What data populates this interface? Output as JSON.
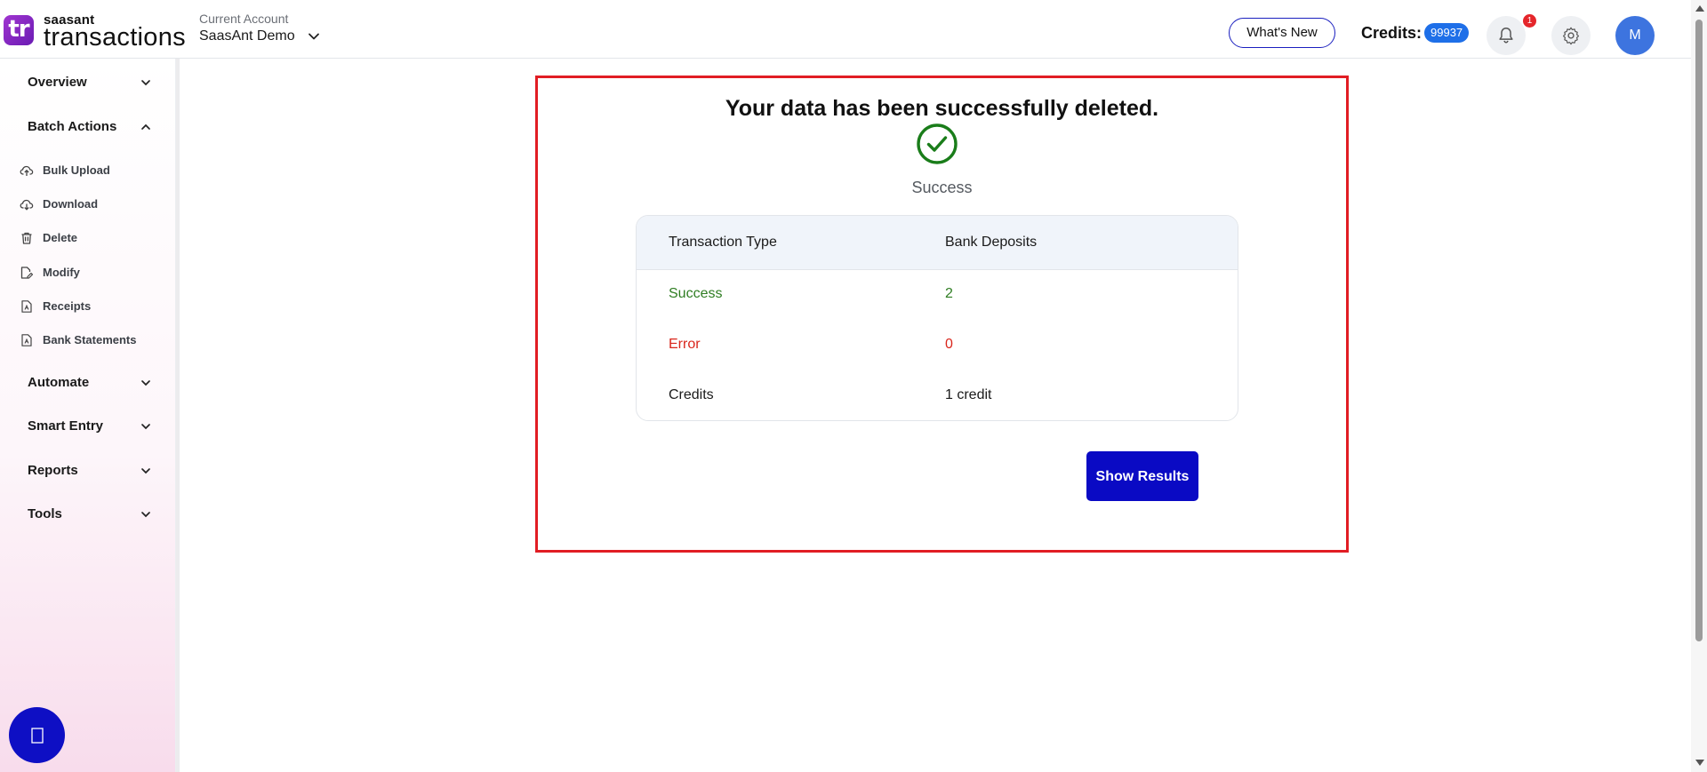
{
  "brand": {
    "logo_mark": "tr",
    "name_small": "saasant",
    "name_big": "transactions"
  },
  "header": {
    "account_label": "Current Account",
    "account_name": "SaasAnt Demo",
    "whats_new_label": "What's New",
    "credits_label": "Credits:",
    "credits_value": "99937",
    "notification_count": "1",
    "avatar_initial": "M"
  },
  "sidebar": {
    "sections": [
      {
        "label": "Overview",
        "expanded": false
      },
      {
        "label": "Batch Actions",
        "expanded": true
      },
      {
        "label": "Automate",
        "expanded": false
      },
      {
        "label": "Smart Entry",
        "expanded": false
      },
      {
        "label": "Reports",
        "expanded": false
      },
      {
        "label": "Tools",
        "expanded": false
      }
    ],
    "batch_items": [
      {
        "label": "Bulk Upload",
        "icon": "cloud-upload-icon"
      },
      {
        "label": "Download",
        "icon": "cloud-download-icon"
      },
      {
        "label": "Delete",
        "icon": "trash-icon"
      },
      {
        "label": "Modify",
        "icon": "edit-file-icon"
      },
      {
        "label": "Receipts",
        "icon": "receipt-file-icon"
      },
      {
        "label": "Bank Statements",
        "icon": "statement-file-icon"
      }
    ],
    "chat_icon": "chat-icon"
  },
  "result": {
    "title": "Your data has been successfully deleted.",
    "status_caption": "Success",
    "table": {
      "header": [
        "Transaction Type",
        "Bank Deposits"
      ],
      "rows": [
        {
          "label": "Success",
          "value": "2"
        },
        {
          "label": "Error",
          "value": "0"
        },
        {
          "label": "Credits",
          "value": "1 credit"
        }
      ]
    },
    "show_results_label": "Show Results"
  },
  "colors": {
    "accent": "#0a0ac4",
    "success": "#2f7d22",
    "error": "#d9261c",
    "highlight_border": "#e11d24",
    "credits_badge": "#1e6fe8"
  }
}
